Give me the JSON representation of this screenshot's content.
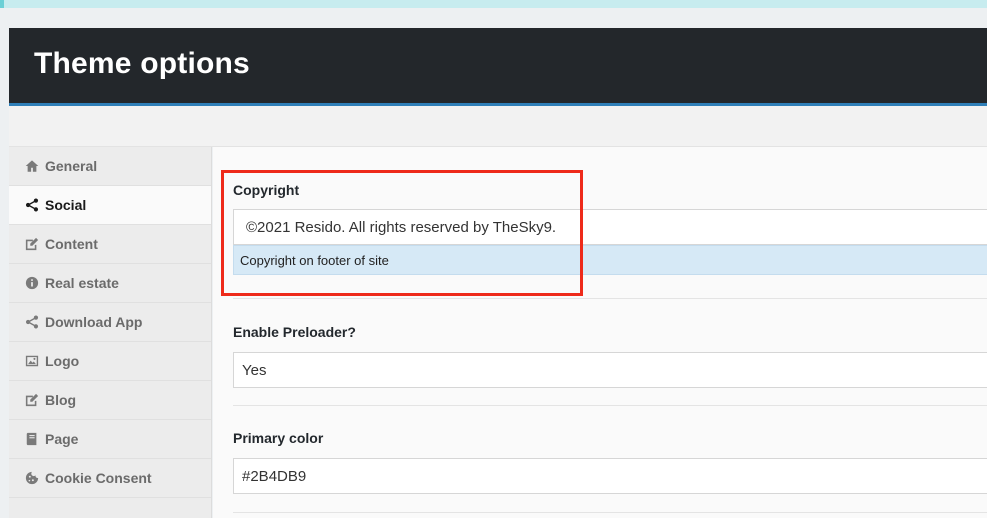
{
  "header": {
    "title": "Theme options"
  },
  "sidebar": {
    "items": [
      {
        "label": "General",
        "icon": "home-icon"
      },
      {
        "label": "Social",
        "icon": "share-icon"
      },
      {
        "label": "Content",
        "icon": "edit-icon"
      },
      {
        "label": "Real estate",
        "icon": "info-icon"
      },
      {
        "label": "Download App",
        "icon": "share-icon"
      },
      {
        "label": "Logo",
        "icon": "image-icon"
      },
      {
        "label": "Blog",
        "icon": "edit-icon"
      },
      {
        "label": "Page",
        "icon": "book-icon"
      },
      {
        "label": "Cookie Consent",
        "icon": "cookie-icon"
      }
    ],
    "active_index": 1
  },
  "fields": {
    "copyright": {
      "label": "Copyright",
      "value": "©2021 Resido. All rights reserved by TheSky9.",
      "description": "Copyright on footer of site"
    },
    "preloader": {
      "label": "Enable Preloader?",
      "value": "Yes"
    },
    "primary_color": {
      "label": "Primary color",
      "value": "#2B4DB9"
    }
  },
  "colors": {
    "header_bg": "#23272b",
    "header_accent": "#2f7fb8",
    "highlight": "#ee2a1a",
    "description_bg": "#d6e9f6"
  }
}
